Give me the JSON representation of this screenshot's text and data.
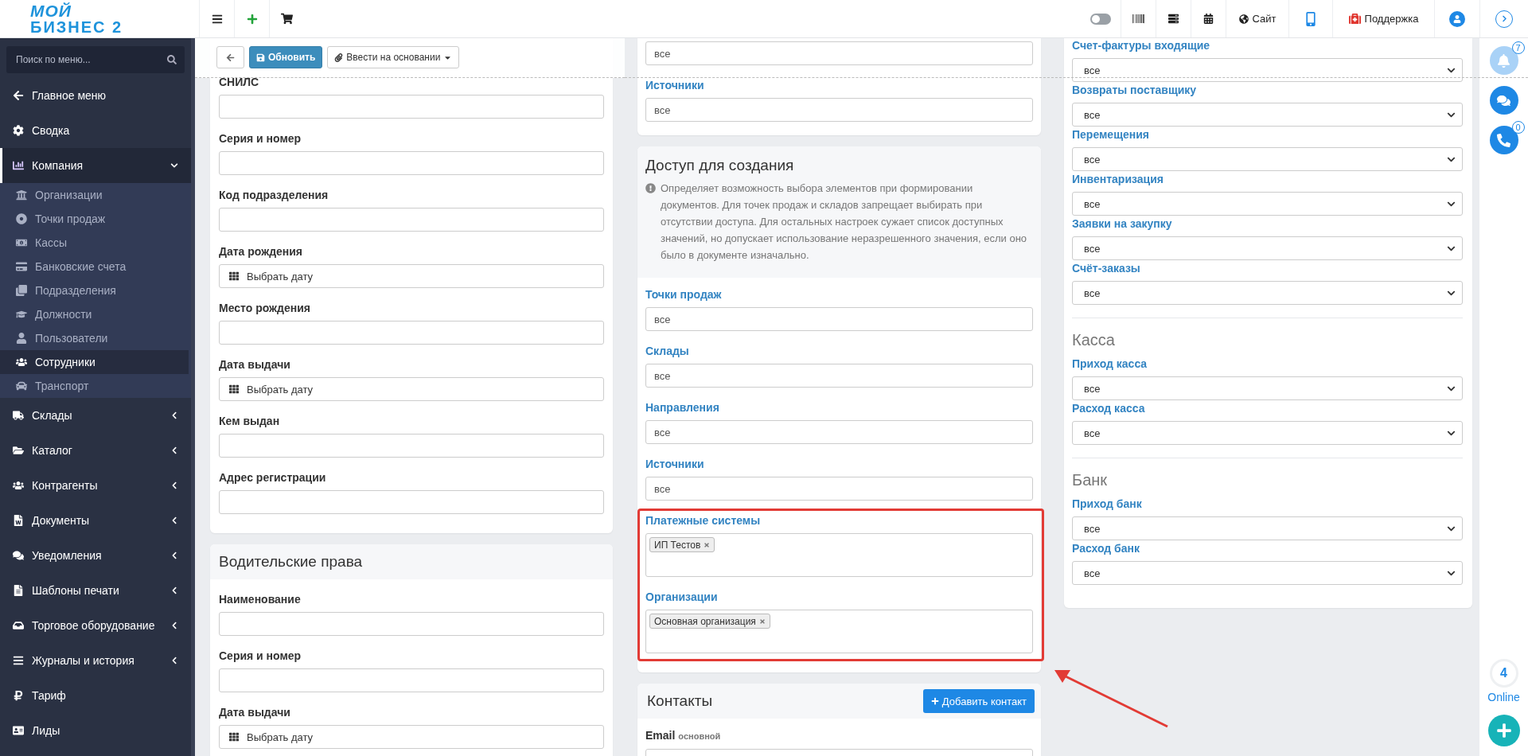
{
  "logo": {
    "top": "МОЙ",
    "bottom": "БИЗНЕС 2"
  },
  "topbar": {
    "theme_switch": {
      "on": false
    },
    "site_link": "Сайт",
    "support_link": "Поддержка"
  },
  "sidebar": {
    "search": {
      "placeholder": "Поиск по меню..."
    },
    "items": [
      {
        "label": "Главное меню",
        "kind": "link",
        "selected": false
      },
      {
        "label": "Сводка",
        "kind": "link",
        "selected": false
      },
      {
        "label": "Компания",
        "kind": "group",
        "selected": true,
        "expanded": true,
        "children": [
          {
            "label": "Организации",
            "selected": false
          },
          {
            "label": "Точки продаж",
            "selected": false
          },
          {
            "label": "Кассы",
            "selected": false
          },
          {
            "label": "Банковские счета",
            "selected": false
          },
          {
            "label": "Подразделения",
            "selected": false
          },
          {
            "label": "Должности",
            "selected": false
          },
          {
            "label": "Пользователи",
            "selected": false
          },
          {
            "label": "Сотрудники",
            "selected": true
          },
          {
            "label": "Транспорт",
            "selected": false
          }
        ]
      },
      {
        "label": "Склады",
        "kind": "group",
        "selected": false,
        "expanded": false
      },
      {
        "label": "Каталог",
        "kind": "group",
        "selected": false,
        "expanded": false
      },
      {
        "label": "Контрагенты",
        "kind": "group",
        "selected": false,
        "expanded": false
      },
      {
        "label": "Документы",
        "kind": "group",
        "selected": false,
        "expanded": false
      },
      {
        "label": "Уведомления",
        "kind": "group",
        "selected": false,
        "expanded": false
      },
      {
        "label": "Шаблоны печати",
        "kind": "group",
        "selected": false,
        "expanded": false
      },
      {
        "label": "Торговое оборудование",
        "kind": "group",
        "selected": false,
        "expanded": false
      },
      {
        "label": "Журналы и история",
        "kind": "group",
        "selected": false,
        "expanded": false
      },
      {
        "label": "Тариф",
        "kind": "link",
        "selected": false
      },
      {
        "label": "Лиды",
        "kind": "link",
        "selected": false
      }
    ]
  },
  "toolbar": {
    "update_button": "Обновить",
    "create_based_on_button": "Ввести на основании"
  },
  "personal_card": {
    "fields": [
      {
        "label": "СНИЛС",
        "kind": "text"
      },
      {
        "label": "Серия и номер",
        "kind": "text"
      },
      {
        "label": "Код подразделения",
        "kind": "text"
      },
      {
        "label": "Дата рождения",
        "kind": "date",
        "value": "Выбрать дату"
      },
      {
        "label": "Место рождения",
        "kind": "text"
      },
      {
        "label": "Дата выдачи",
        "kind": "date",
        "value": "Выбрать дату"
      },
      {
        "label": "Кем выдан",
        "kind": "text"
      },
      {
        "label": "Адрес регистрации",
        "kind": "text"
      }
    ]
  },
  "license_card": {
    "title": "Водительские права",
    "fields": [
      {
        "label": "Наименование",
        "kind": "text"
      },
      {
        "label": "Серия и номер",
        "kind": "text"
      },
      {
        "label": "Дата выдачи",
        "kind": "date",
        "value": "Выбрать дату"
      }
    ]
  },
  "view_access_card": {
    "fields": [
      {
        "kind": "filter",
        "placeholder": "все"
      },
      {
        "kind": "filter",
        "label": "Источники",
        "placeholder": "все"
      }
    ]
  },
  "create_access_card": {
    "title": "Доступ для создания",
    "description": "Определяет возможность выбора элементов при формировании документов. Для точек продаж и складов запрещает выбирать при отсутствии доступа. Для остальных настроек сужает список доступных значений, но допускает использование неразрешенного значения, если оно было в документе изначально.",
    "fields": [
      {
        "kind": "filter",
        "label": "Точки продаж",
        "placeholder": "все"
      },
      {
        "kind": "filter",
        "label": "Склады",
        "placeholder": "все"
      },
      {
        "kind": "filter",
        "label": "Направления",
        "placeholder": "все"
      },
      {
        "kind": "filter",
        "label": "Источники",
        "placeholder": "все"
      },
      {
        "kind": "tags",
        "label": "Платежные системы",
        "tags": [
          "ИП Тестов"
        ]
      },
      {
        "kind": "tags",
        "label": "Организации",
        "tags": [
          "Основная организация"
        ]
      }
    ]
  },
  "contacts_card": {
    "title": "Контакты",
    "add_button": "Добавить контакт",
    "fields": [
      {
        "label": "Email",
        "hint": "основной"
      }
    ]
  },
  "document_access_card": {
    "sections": [
      {
        "fields": [
          {
            "label": "Счет-фактуры входящие",
            "value": "все"
          },
          {
            "label": "Возвраты поставщику",
            "value": "все"
          },
          {
            "label": "Перемещения",
            "value": "все"
          },
          {
            "label": "Инвентаризация",
            "value": "все"
          },
          {
            "label": "Заявки на закупку",
            "value": "все"
          },
          {
            "label": "Счёт-заказы",
            "value": "все"
          }
        ]
      },
      {
        "title": "Касса",
        "fields": [
          {
            "label": "Приход касса",
            "value": "все"
          },
          {
            "label": "Расход касса",
            "value": "все"
          }
        ]
      },
      {
        "title": "Банк",
        "fields": [
          {
            "label": "Приход банк",
            "value": "все"
          },
          {
            "label": "Расход банк",
            "value": "все"
          }
        ]
      }
    ]
  },
  "right_rail": {
    "notifications_badge": "7",
    "calls_badge": "0",
    "online_count": "4",
    "online_label": "Online"
  }
}
